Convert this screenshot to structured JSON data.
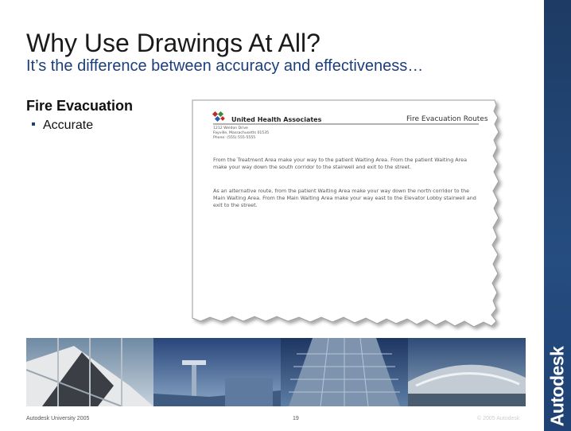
{
  "slide": {
    "title": "Why Use Drawings At All?",
    "subtitle": "It’s the difference between accuracy and effectiveness…",
    "section_heading": "Fire Evacuation",
    "bullets": [
      "Accurate"
    ]
  },
  "document": {
    "company": "United Health Associates",
    "heading": "Fire Evacuation Routes",
    "address_lines": [
      "1212 Weldon Drive",
      "Fayville, Massachusetts 01535",
      "Phone:  (555) 555-5555"
    ],
    "paragraphs": [
      "From the Treatment Area make your way to the patient Waiting Area.  From the patient Waiting Area make your way down the south corridor to the stairwell and exit to the street.",
      "As an alternative route, from the patient Waiting Area make your way down the north corridor to the Main Waiting Area.  From the Main Waiting Area make your way east to the Elevator Lobby stairwell and exit to the street."
    ]
  },
  "footer": {
    "left": "Autodesk University 2005",
    "page": "19",
    "copyright": "© 2005 Autodesk"
  },
  "brand": {
    "name": "Autodesk",
    "sidebar_color": "#1f4173"
  },
  "colors": {
    "title": "#1a1a1a",
    "subtitle": "#1c3f7a",
    "logo_red": "#c0272d",
    "logo_green": "#3c8a3c",
    "logo_blue": "#2a5aa8"
  }
}
